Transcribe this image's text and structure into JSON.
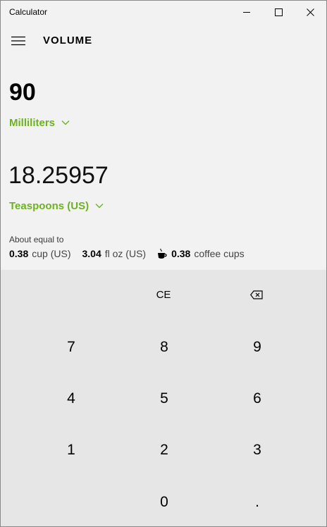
{
  "window": {
    "title": "Calculator"
  },
  "header": {
    "mode_title": "VOLUME",
    "menu_icon": "hamburger-icon"
  },
  "converter": {
    "from_value": "90",
    "from_unit": "Milliliters",
    "to_value": "18.25957",
    "to_unit": "Teaspoons (US)",
    "accent_color": "#6cb31f"
  },
  "equivalents": {
    "label": "About equal to",
    "items": [
      {
        "value": "0.38",
        "unit": "cup (US)"
      },
      {
        "value": "3.04",
        "unit": "fl oz (US)"
      },
      {
        "value": "0.38",
        "unit": "coffee cups",
        "icon": "coffee-cup-icon"
      }
    ]
  },
  "keypad": {
    "ce": "CE",
    "backspace_icon": "backspace-icon",
    "digits": {
      "k7": "7",
      "k8": "8",
      "k9": "9",
      "k4": "4",
      "k5": "5",
      "k6": "6",
      "k1": "1",
      "k2": "2",
      "k3": "3",
      "k0": "0",
      "dot": "."
    }
  }
}
